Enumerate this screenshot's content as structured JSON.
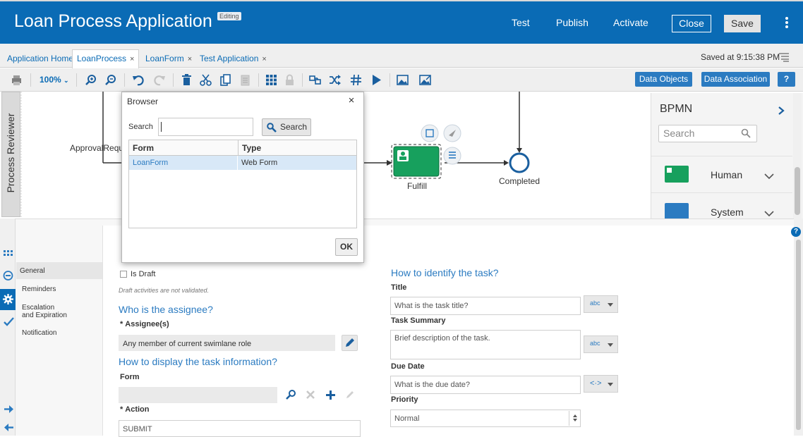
{
  "header": {
    "title": "Loan Process Application",
    "badge": "Editing",
    "links": [
      "Test",
      "Publish",
      "Activate"
    ],
    "close_label": "Close",
    "save_label": "Save",
    "accent": "#0a6bb5"
  },
  "tabs": {
    "items": [
      {
        "label": "Application Home"
      },
      {
        "label": "LoanProcess"
      },
      {
        "label": "LoanForm"
      },
      {
        "label": "Test Application"
      }
    ],
    "active": "LoanProcess",
    "close_glyph": "×",
    "saved_text": "Saved at 9:15:38 PM"
  },
  "toolbar": {
    "zoom_label": "100%",
    "data_objects_label": "Data Objects",
    "data_association_label": "Data Association",
    "help_label": "?"
  },
  "canvas": {
    "reviewer_label": "Process Reviewer",
    "lane_label": "ApprovalRequ",
    "fulfill_label": "Fulfill",
    "completed_label": "Completed"
  },
  "palette": {
    "title": "BPMN",
    "search_placeholder": "Search",
    "items": [
      {
        "label": "Human",
        "color": "#17a05d"
      },
      {
        "label": "System",
        "color": "#2b7bc1"
      }
    ]
  },
  "sidenav": {
    "items": [
      "General",
      "Reminders",
      "Escalation",
      "and Expiration",
      "Notification"
    ],
    "active": "General"
  },
  "form": {
    "is_draft_label": "Is Draft",
    "draft_note": "Draft activities are not validated.",
    "assignee_section": "Who is the assignee?",
    "assignee_label": "Assignee(s)",
    "assignee_value": "Any member of current swimlane role",
    "display_section": "How to display the task information?",
    "form_label": "Form",
    "form_value": "",
    "action_label": "Action",
    "action_value": "SUBMIT",
    "identify_section": "How to identify the task?",
    "title_label": "Title",
    "title_placeholder": "What is the task title?",
    "summary_label": "Task Summary",
    "summary_placeholder": "Brief description of the task.",
    "due_label": "Due Date",
    "due_placeholder": "What is the due date?",
    "priority_label": "Priority",
    "priority_value": "Normal",
    "abc_label": "abc",
    "expr_label": "<·>"
  },
  "dialog": {
    "title": "Browser",
    "close_glyph": "×",
    "search_label": "Search",
    "search_value": "",
    "search_button": "Search",
    "columns": [
      "Form",
      "Type"
    ],
    "rows": [
      {
        "form": "LoanForm",
        "type": "Web Form"
      }
    ],
    "ok_label": "OK"
  }
}
